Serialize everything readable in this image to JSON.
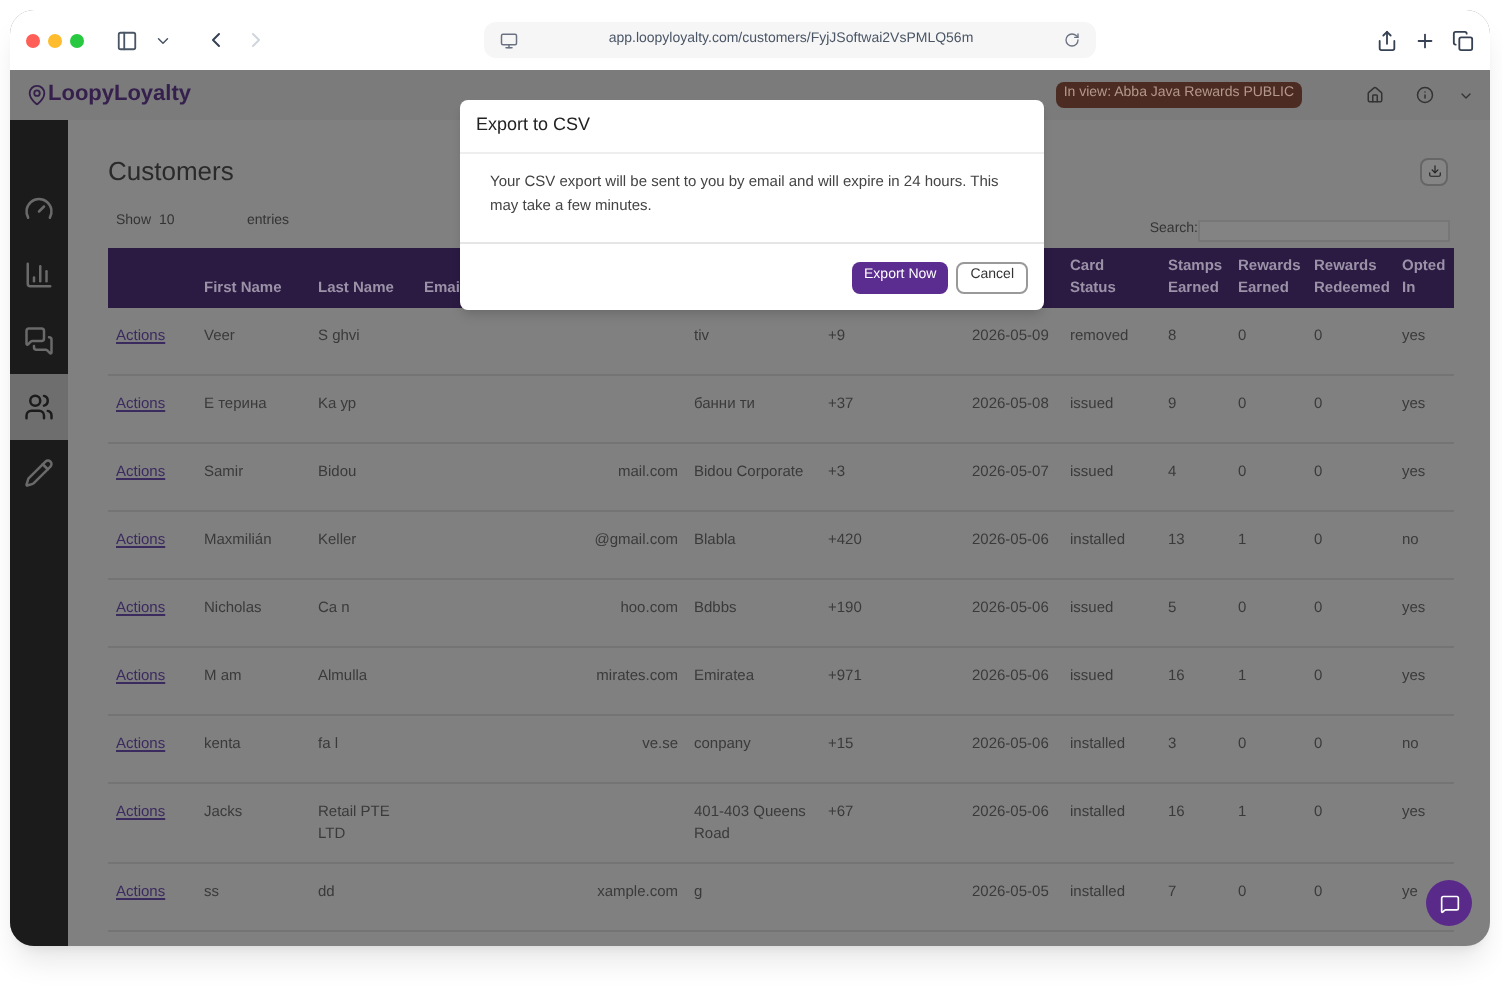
{
  "browser": {
    "url": "app.loopyloyalty.com/customers/FyjJSoftwai2VsPMLQ56m"
  },
  "app": {
    "logo": "LoopyLoyalty",
    "view_badge": "In view: Abba Java Rewards PUBLIC"
  },
  "sidebar": {
    "items": [
      {
        "kind": "dashboard",
        "selected": false
      },
      {
        "kind": "chart",
        "selected": false
      },
      {
        "kind": "chat",
        "selected": false
      },
      {
        "kind": "users",
        "selected": true
      },
      {
        "kind": "pencil",
        "selected": false
      }
    ]
  },
  "page": {
    "title": "Customers",
    "show_label": "Show",
    "page_size": "10",
    "entries_label": "entries",
    "search_label": "Search:"
  },
  "table": {
    "columns": {
      "first_name": "First Name",
      "last_name": "Last Name",
      "email": "Emai",
      "card_status": "Card Status",
      "stamps": "Stamps Earned",
      "rewards_earned": "Rewards Earned",
      "rewards_redeemed": "Rewards Redeemed",
      "opted_in": "Opted In"
    },
    "rows": [
      {
        "action": "Actions",
        "first_name": "Veer",
        "last_name": "S  ghvi",
        "column_5": "tiv",
        "column_6": "+9",
        "column_7": "2026-05-09",
        "card_status": "removed",
        "stamps": "8",
        "rewards_earned": "0",
        "rewards_redeemed": "0",
        "opted_in": "yes"
      },
      {
        "action": "Actions",
        "first_name": "E  терина",
        "last_name": "Ka  ур",
        "column_5": "банни ти",
        "column_6": "+37",
        "column_7": "2026-05-08",
        "card_status": "issued",
        "stamps": "9",
        "rewards_earned": "0",
        "rewards_redeemed": "0",
        "opted_in": "yes"
      },
      {
        "action": "Actions",
        "first_name": "Samir",
        "last_name": "Bidou",
        "email": "mail.com",
        "column_5": "Bidou Corporate",
        "column_6": "+3",
        "column_7": "2026-05-07",
        "card_status": "issued",
        "stamps": "4",
        "rewards_earned": "0",
        "rewards_redeemed": "0",
        "opted_in": "yes"
      },
      {
        "action": "Actions",
        "first_name": "Maxmilián",
        "last_name": "Keller",
        "email": "@gmail.com",
        "column_5": "Blabla",
        "column_6": "+420",
        "column_7": "2026-05-06",
        "card_status": "installed",
        "stamps": "13",
        "rewards_earned": "1",
        "rewards_redeemed": "0",
        "opted_in": "no"
      },
      {
        "action": "Actions",
        "first_name": "Nicholas",
        "last_name": "Ca  n",
        "email": "hoo.com",
        "column_5": "Bdbbs",
        "column_6": "+190",
        "column_7": "2026-05-06",
        "card_status": "issued",
        "stamps": "5",
        "rewards_earned": "0",
        "rewards_redeemed": "0",
        "opted_in": "yes"
      },
      {
        "action": "Actions",
        "first_name": "M  am",
        "last_name": "Almulla",
        "email": "mirates.com",
        "column_5": "Emiratea",
        "column_6": "+971",
        "column_7": "2026-05-06",
        "card_status": "issued",
        "stamps": "16",
        "rewards_earned": "1",
        "rewards_redeemed": "0",
        "opted_in": "yes"
      },
      {
        "action": "Actions",
        "first_name": "kenta",
        "last_name": "fa  l",
        "email": "ve.se",
        "column_5": "conpany",
        "column_6": "+15",
        "column_7": "2026-05-06",
        "card_status": "installed",
        "stamps": "3",
        "rewards_earned": "0",
        "rewards_redeemed": "0",
        "opted_in": "no"
      },
      {
        "action": "Actions",
        "first_name": "Jacks",
        "last_name": "Retail PTE LTD",
        "column_5": "401-403 Queens Road",
        "column_6": "+67",
        "column_7": "2026-05-06",
        "card_status": "installed",
        "stamps": "16",
        "rewards_earned": "1",
        "rewards_redeemed": "0",
        "opted_in": "yes"
      },
      {
        "action": "Actions",
        "first_name": "ss",
        "last_name": "dd",
        "email": "xample.com",
        "column_5": "g",
        "column_7": "2026-05-05",
        "card_status": "installed",
        "stamps": "7",
        "rewards_earned": "0",
        "rewards_redeemed": "0",
        "opted_in": "ye"
      }
    ]
  },
  "modal": {
    "title": "Export to CSV",
    "message": "Your CSV export will be sent to you by email and will expire in 24 hours. This may take a few minutes.",
    "buttons": [
      {
        "label": "Export Now",
        "kind": "primary"
      },
      {
        "label": "Cancel",
        "kind": "secondary"
      }
    ]
  }
}
